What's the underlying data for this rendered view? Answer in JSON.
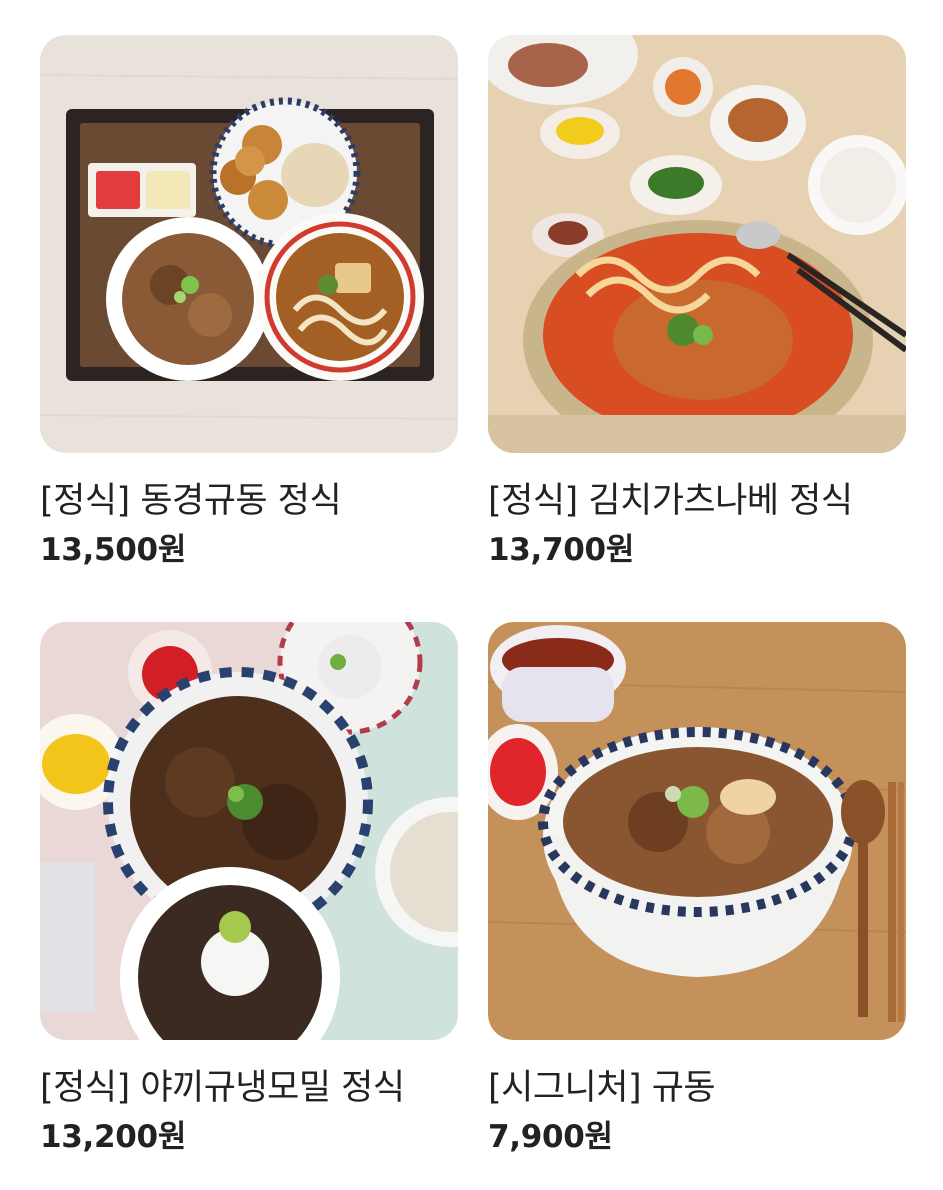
{
  "menu_items": [
    {
      "name": "[정식] 동경규동 정식",
      "price": "13,500원",
      "image": "gyudon-set-tray-photo"
    },
    {
      "name": "[정식] 김치가츠나베 정식",
      "price": "13,700원",
      "image": "kimchi-katsu-nabe-photo"
    },
    {
      "name": "[정식] 야끼규냉모밀 정식",
      "price": "13,200원",
      "image": "yakigyu-cold-soba-photo"
    },
    {
      "name": "[시그니처] 규동",
      "price": "7,900원",
      "image": "signature-gyudon-photo"
    }
  ]
}
